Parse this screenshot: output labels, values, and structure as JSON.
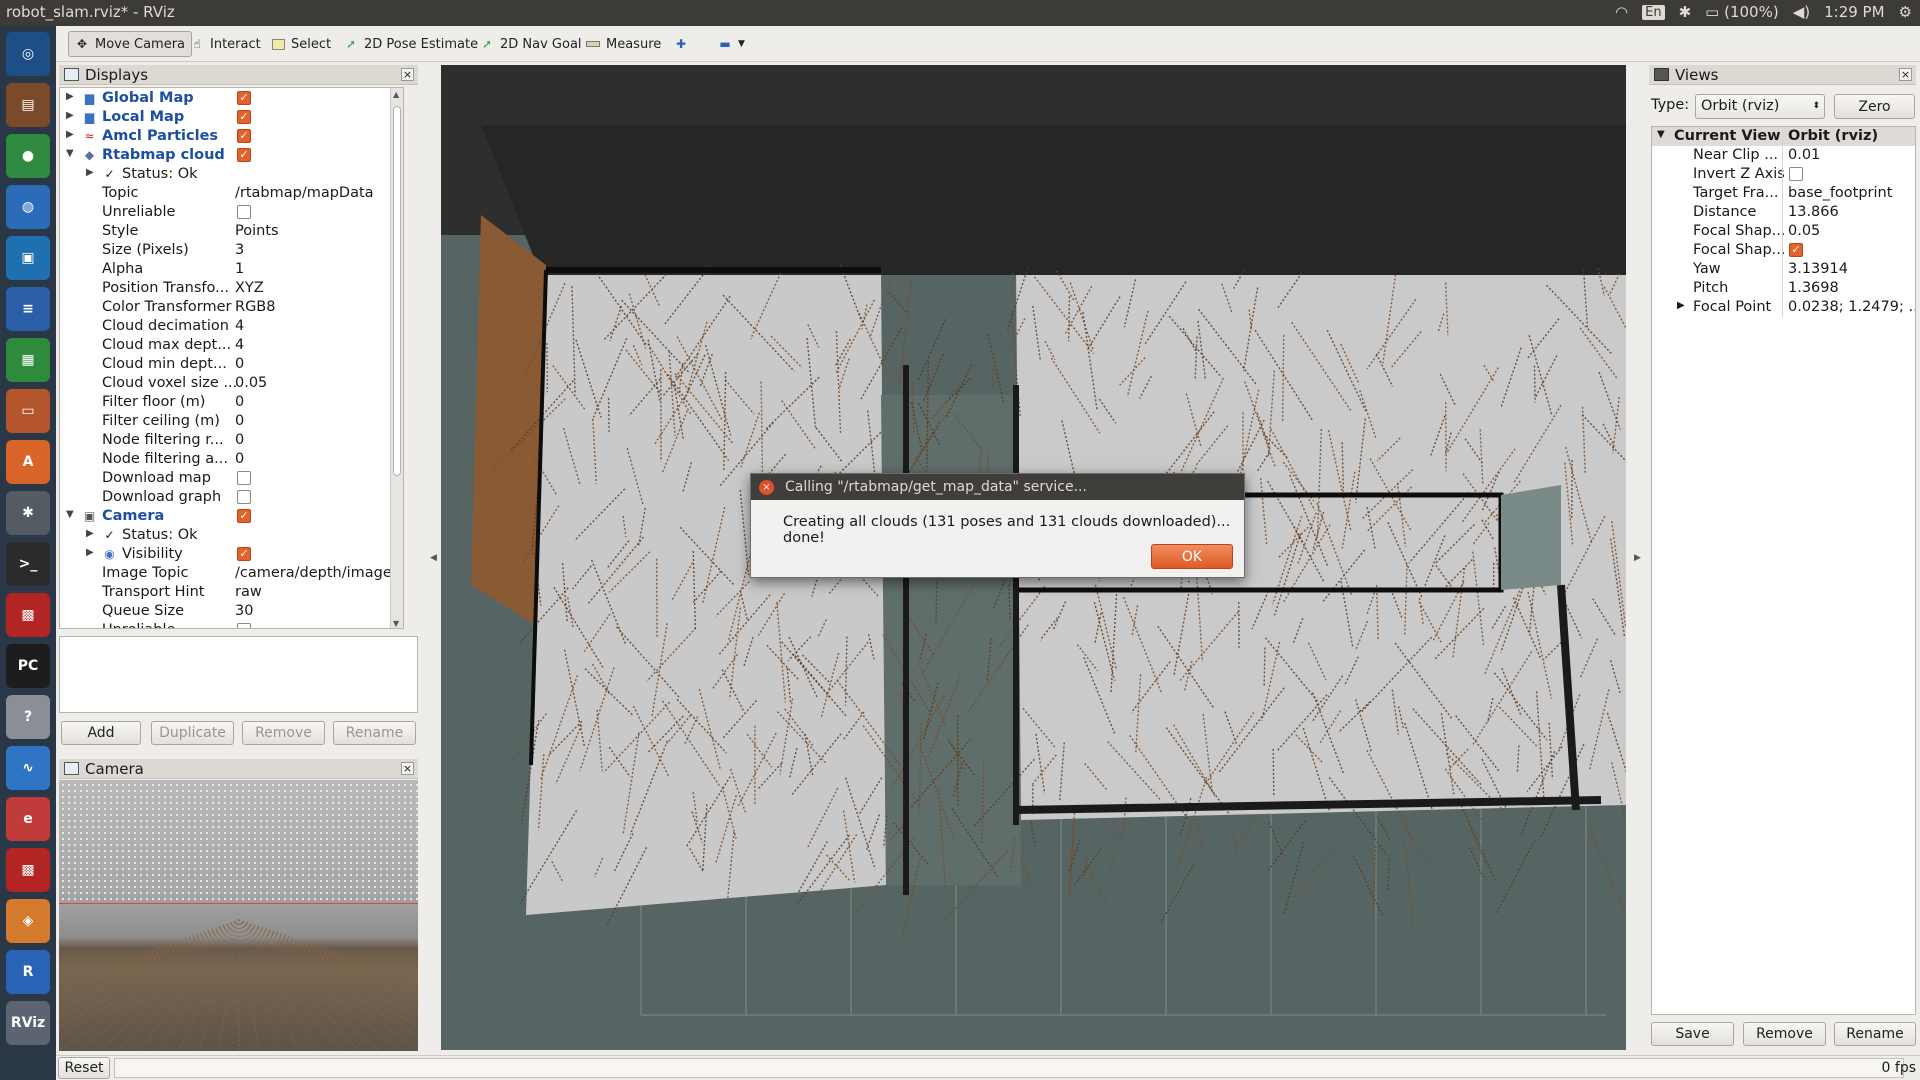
{
  "window": {
    "title": "robot_slam.rviz* - RViz"
  },
  "system_tray": {
    "keyboard": "En",
    "battery": "(100%)",
    "time": "1:29 PM"
  },
  "launcher_icons": [
    {
      "name": "dash-icon",
      "color": "#1d4f86",
      "glyph": "◎"
    },
    {
      "name": "files-icon",
      "color": "#7a4a2a",
      "glyph": "▤"
    },
    {
      "name": "chrome-icon",
      "color": "#2d8a3e",
      "glyph": "●"
    },
    {
      "name": "globe-icon",
      "color": "#2a6cb8",
      "glyph": "◍"
    },
    {
      "name": "vm-icon",
      "color": "#1f70b0",
      "glyph": "▣"
    },
    {
      "name": "writer-icon",
      "color": "#2a5fa8",
      "glyph": "≡"
    },
    {
      "name": "calc-icon",
      "color": "#2e8b3c",
      "glyph": "▦"
    },
    {
      "name": "impress-icon",
      "color": "#b5552c",
      "glyph": "▭"
    },
    {
      "name": "software-center-icon",
      "color": "#d9642a",
      "glyph": "A"
    },
    {
      "name": "settings-icon",
      "color": "#555b63",
      "glyph": "✱"
    },
    {
      "name": "terminal-icon",
      "color": "#2b2b2b",
      "glyph": ">_"
    },
    {
      "name": "app-red-icon",
      "color": "#b32424",
      "glyph": "▩"
    },
    {
      "name": "pycharm-icon",
      "color": "#1d1d1d",
      "glyph": "PC"
    },
    {
      "name": "help-icon",
      "color": "#8a8f96",
      "glyph": "?"
    },
    {
      "name": "monitor-icon",
      "color": "#2f75c4",
      "glyph": "∿"
    },
    {
      "name": "editor-icon",
      "color": "#c23b3b",
      "glyph": "e"
    },
    {
      "name": "app-red2-icon",
      "color": "#b32424",
      "glyph": "▩"
    },
    {
      "name": "blender-icon",
      "color": "#d47a2c",
      "glyph": "◈"
    },
    {
      "name": "r-icon",
      "color": "#2a62b5",
      "glyph": "R"
    },
    {
      "name": "rviz-icon",
      "color": "#5b6470",
      "glyph": "RViz"
    }
  ],
  "toolbar": {
    "tools": [
      {
        "name": "move-camera-tool",
        "label": "Move Camera",
        "icon": "✥",
        "active": true
      },
      {
        "name": "interact-tool",
        "label": "Interact",
        "icon": "☝"
      },
      {
        "name": "select-tool",
        "label": "Select",
        "icon": "▭"
      },
      {
        "name": "pose-estimate-tool",
        "label": "2D Pose Estimate",
        "icon": "➚"
      },
      {
        "name": "nav-goal-tool",
        "label": "2D Nav Goal",
        "icon": "➚"
      },
      {
        "name": "measure-tool",
        "label": "Measure",
        "icon": "▬"
      }
    ]
  },
  "displays": {
    "title": "Displays",
    "rows": [
      {
        "level": 0,
        "arrow": "▶",
        "icon": "folder",
        "name": "Global Map",
        "bold": true,
        "checkbox": true
      },
      {
        "level": 0,
        "arrow": "▶",
        "icon": "folder",
        "name": "Local Map",
        "bold": true,
        "checkbox": true
      },
      {
        "level": 0,
        "arrow": "▶",
        "icon": "particles",
        "name": "Amcl Particles",
        "bold": true,
        "checkbox": true
      },
      {
        "level": 0,
        "arrow": "▼",
        "icon": "cloud",
        "name": "Rtabmap cloud",
        "bold": true,
        "checkbox": true
      },
      {
        "level": 1,
        "arrow": "▶",
        "icon": "check",
        "name": "Status: Ok"
      },
      {
        "level": 1,
        "name": "Topic",
        "value": "/rtabmap/mapData"
      },
      {
        "level": 1,
        "name": "Unreliable",
        "checkbox": false
      },
      {
        "level": 1,
        "name": "Style",
        "value": "Points"
      },
      {
        "level": 1,
        "name": "Size (Pixels)",
        "value": "3"
      },
      {
        "level": 1,
        "name": "Alpha",
        "value": "1"
      },
      {
        "level": 1,
        "name": "Position Transfo...",
        "value": "XYZ"
      },
      {
        "level": 1,
        "name": "Color Transformer",
        "value": "RGB8"
      },
      {
        "level": 1,
        "name": "Cloud decimation",
        "value": "4"
      },
      {
        "level": 1,
        "name": "Cloud max dept...",
        "value": "4"
      },
      {
        "level": 1,
        "name": "Cloud min dept...",
        "value": "0"
      },
      {
        "level": 1,
        "name": "Cloud voxel size ...",
        "value": "0.05"
      },
      {
        "level": 1,
        "name": "Filter floor (m)",
        "value": "0"
      },
      {
        "level": 1,
        "name": "Filter ceiling (m)",
        "value": "0"
      },
      {
        "level": 1,
        "name": "Node filtering r...",
        "value": "0"
      },
      {
        "level": 1,
        "name": "Node filtering a...",
        "value": "0"
      },
      {
        "level": 1,
        "name": "Download map",
        "checkbox": false
      },
      {
        "level": 1,
        "name": "Download graph",
        "checkbox": false
      },
      {
        "level": 0,
        "arrow": "▼",
        "icon": "camera",
        "name": "Camera",
        "bold": true,
        "checkbox": true
      },
      {
        "level": 1,
        "arrow": "▶",
        "icon": "check",
        "name": "Status: Ok"
      },
      {
        "level": 1,
        "arrow": "▶",
        "icon": "eye",
        "name": "Visibility",
        "checkbox": true
      },
      {
        "level": 1,
        "name": "Image Topic",
        "value": "/camera/depth/image..."
      },
      {
        "level": 1,
        "name": "Transport Hint",
        "value": "raw"
      },
      {
        "level": 1,
        "name": "Queue Size",
        "value": "30"
      },
      {
        "level": 1,
        "name": "Unreliable",
        "checkbox": false
      }
    ],
    "buttons": {
      "add": "Add",
      "duplicate": "Duplicate",
      "remove": "Remove",
      "rename": "Rename"
    }
  },
  "camera_panel": {
    "title": "Camera"
  },
  "dialog": {
    "title": "Calling \"/rtabmap/get_map_data\" service...",
    "message": "Creating all clouds (131 poses and 131 clouds downloaded)... done!",
    "ok_label": "OK"
  },
  "views": {
    "title": "Views",
    "type_label": "Type:",
    "type_value": "Orbit (rviz)",
    "zero_label": "Zero",
    "header": {
      "name": "Current View",
      "value": "Orbit (rviz)"
    },
    "rows": [
      {
        "name": "Near Clip ...",
        "value": "0.01"
      },
      {
        "name": "Invert Z Axis",
        "checkbox": false
      },
      {
        "name": "Target Fra...",
        "value": "base_footprint"
      },
      {
        "name": "Distance",
        "value": "13.866"
      },
      {
        "name": "Focal Shap...",
        "value": "0.05"
      },
      {
        "name": "Focal Shap...",
        "checkbox": true
      },
      {
        "name": "Yaw",
        "value": "3.13914"
      },
      {
        "name": "Pitch",
        "value": "1.3698"
      },
      {
        "name": "Focal Point",
        "value": "0.0238; 1.2479; ...",
        "arrow": "▶"
      }
    ],
    "buttons": {
      "save": "Save",
      "remove": "Remove",
      "rename": "Rename"
    }
  },
  "statusbar": {
    "reset_label": "Reset",
    "fps": "0 fps"
  },
  "colors": {
    "accent": "#e4622c",
    "map_floor": "#c9c9c9",
    "cloud_brown": "#7a4a25",
    "floor_grid": "#4a5a58"
  }
}
